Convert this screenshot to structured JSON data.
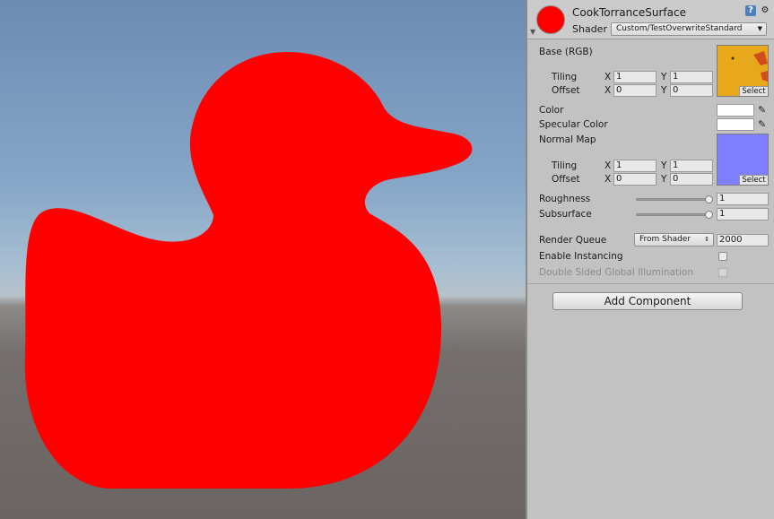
{
  "scene": {
    "duck_color": "#ff0000"
  },
  "inspector": {
    "material_name": "CookTorranceSurface",
    "shader_label": "Shader",
    "shader_value": "Custom/TestOverwriteStandard",
    "base": {
      "label": "Base (RGB)",
      "tiling_label": "Tiling",
      "offset_label": "Offset",
      "tiling_x": "1",
      "tiling_y": "1",
      "offset_x": "0",
      "offset_y": "0",
      "select_label": "Select"
    },
    "color_label": "Color",
    "specular_label": "Specular Color",
    "normal": {
      "label": "Normal Map",
      "tiling_label": "Tiling",
      "offset_label": "Offset",
      "tiling_x": "1",
      "tiling_y": "1",
      "offset_x": "0",
      "offset_y": "0",
      "select_label": "Select"
    },
    "axis_x": "X",
    "axis_y": "Y",
    "roughness_label": "Roughness",
    "roughness_value": "1",
    "subsurface_label": "Subsurface",
    "subsurface_value": "1",
    "render_queue_label": "Render Queue",
    "render_queue_mode": "From Shader",
    "render_queue_value": "2000",
    "instancing_label": "Enable Instancing",
    "instancing_checked": false,
    "double_sided_label": "Double Sided Global Illumination",
    "double_sided_checked": false,
    "add_component_label": "Add Component"
  }
}
